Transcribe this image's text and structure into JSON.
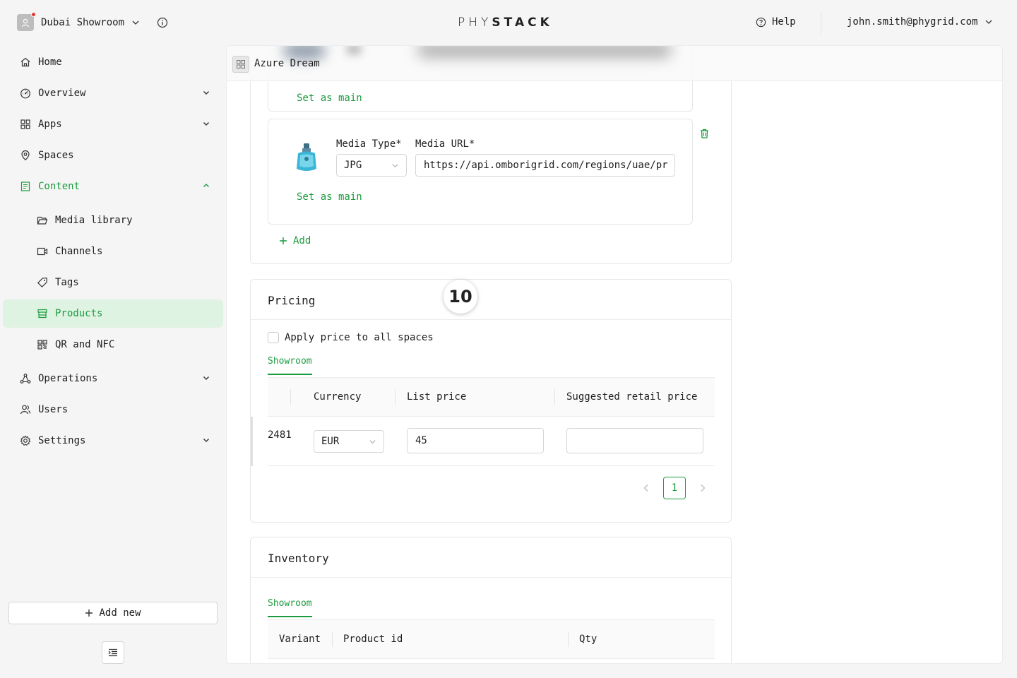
{
  "topbar": {
    "org_name": "Dubai Showroom",
    "logo_light": "PHY",
    "logo_bold": "STACK",
    "help_label": "Help",
    "user_email": "john.smith@phygrid.com"
  },
  "sidebar": {
    "items": [
      {
        "label": "Home",
        "icon": "home-icon"
      },
      {
        "label": "Overview",
        "icon": "dashboard-icon"
      },
      {
        "label": "Apps",
        "icon": "apps-grid-icon"
      },
      {
        "label": "Spaces",
        "icon": "location-pin-icon"
      },
      {
        "label": "Content",
        "icon": "content-icon"
      },
      {
        "label": "Media library",
        "icon": "folder-open-icon"
      },
      {
        "label": "Channels",
        "icon": "video-camera-icon"
      },
      {
        "label": "Tags",
        "icon": "tag-icon"
      },
      {
        "label": "Products",
        "icon": "shop-icon"
      },
      {
        "label": "QR and NFC",
        "icon": "qrcode-icon"
      },
      {
        "label": "Operations",
        "icon": "cluster-icon"
      },
      {
        "label": "Users",
        "icon": "users-icon"
      },
      {
        "label": "Settings",
        "icon": "settings-icon"
      }
    ],
    "add_new_label": "Add new"
  },
  "header": {
    "title": "Azure Dream"
  },
  "media": {
    "set_as_main_label": "Set as main",
    "media_type_label": "Media Type",
    "media_url_label": "Media URL",
    "required_marker": "*",
    "media_type_value": "JPG",
    "media_url_value": "https://api.omborigrid.com/regions/uae/pr",
    "add_label": "Add"
  },
  "pricing": {
    "title": "Pricing",
    "apply_all_label": "Apply price to all spaces",
    "tab_label": "Showroom",
    "columns": [
      "Currency",
      "List price",
      "Suggested retail price"
    ],
    "row": {
      "id_fragment": "2481",
      "currency": "EUR",
      "list_price": "45",
      "suggested_retail_price": ""
    },
    "current_page": "1"
  },
  "inventory": {
    "title": "Inventory",
    "tab_label": "Showroom",
    "columns": [
      "Variant",
      "Product id",
      "Qty"
    ]
  },
  "step_badge": "10",
  "colors": {
    "accent": "#1a9c3e",
    "active_bg": "#dff3e2"
  }
}
